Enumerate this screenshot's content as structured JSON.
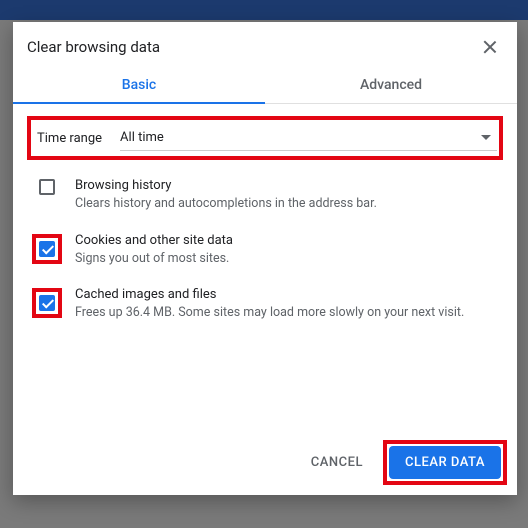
{
  "dialog": {
    "title": "Clear browsing data",
    "tabs": {
      "basic": "Basic",
      "advanced": "Advanced"
    },
    "time_range": {
      "label": "Time range",
      "value": "All time"
    },
    "options": [
      {
        "title": "Browsing history",
        "desc": "Clears history and autocompletions in the address bar.",
        "checked": false
      },
      {
        "title": "Cookies and other site data",
        "desc": "Signs you out of most sites.",
        "checked": true
      },
      {
        "title": "Cached images and files",
        "desc": "Frees up 36.4 MB. Some sites may load more slowly on your next visit.",
        "checked": true
      }
    ],
    "buttons": {
      "cancel": "CANCEL",
      "clear": "CLEAR DATA"
    }
  }
}
